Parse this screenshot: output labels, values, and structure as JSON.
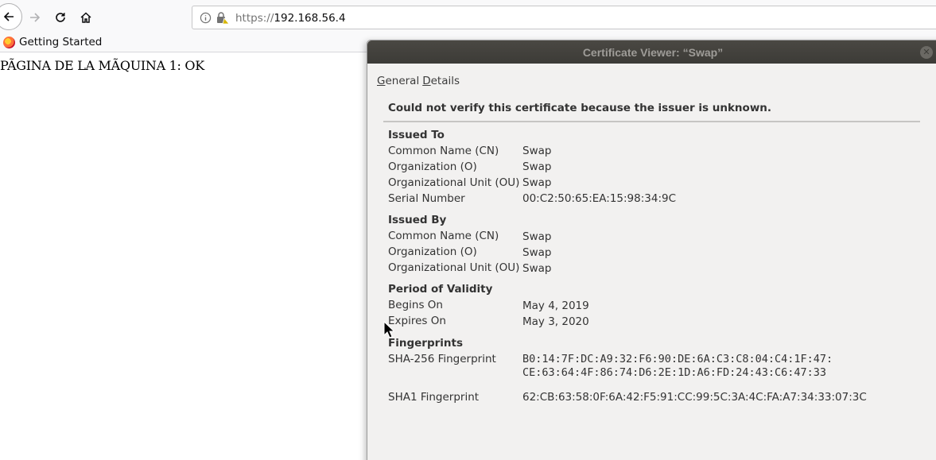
{
  "browser": {
    "url_scheme": "https://",
    "url_host": "192.168.56.4",
    "bookmark": "Getting Started"
  },
  "page": {
    "text": "PÃGINA DE LA MÃQUINA 1: OK"
  },
  "dialog": {
    "title": "Certificate Viewer: “Swap”",
    "tabs": {
      "general_first": "G",
      "general_rest": "eneral",
      "details_first": "D",
      "details_rest": "etails"
    },
    "warning": "Could not verify this certificate because the issuer is unknown.",
    "issued_to": {
      "heading": "Issued To",
      "cn_label": "Common Name (CN)",
      "cn": "Swap",
      "o_label": "Organization (O)",
      "o": "Swap",
      "ou_label": "Organizational Unit (OU)",
      "ou": "Swap",
      "serial_label": "Serial Number",
      "serial": "00:C2:50:65:EA:15:98:34:9C"
    },
    "issued_by": {
      "heading": "Issued By",
      "cn_label": "Common Name (CN)",
      "cn": "Swap",
      "o_label": "Organization (O)",
      "o": "Swap",
      "ou_label": "Organizational Unit (OU)",
      "ou": "Swap"
    },
    "validity": {
      "heading": "Period of Validity",
      "begins_label": "Begins On",
      "begins": "May 4, 2019",
      "expires_label": "Expires On",
      "expires": "May 3, 2020"
    },
    "fingerprints": {
      "heading": "Fingerprints",
      "sha256_label": "SHA-256 Fingerprint",
      "sha256_line1": "B0:14:7F:DC:A9:32:F6:90:DE:6A:C3:C8:04:C4:1F:47:",
      "sha256_line2": "CE:63:64:4F:86:74:D6:2E:1D:A6:FD:24:43:C6:47:33",
      "sha1_label": "SHA1 Fingerprint",
      "sha1": "62:CB:63:58:0F:6A:42:F5:91:CC:99:5C:3A:4C:FA:A7:34:33:07:3C"
    }
  }
}
